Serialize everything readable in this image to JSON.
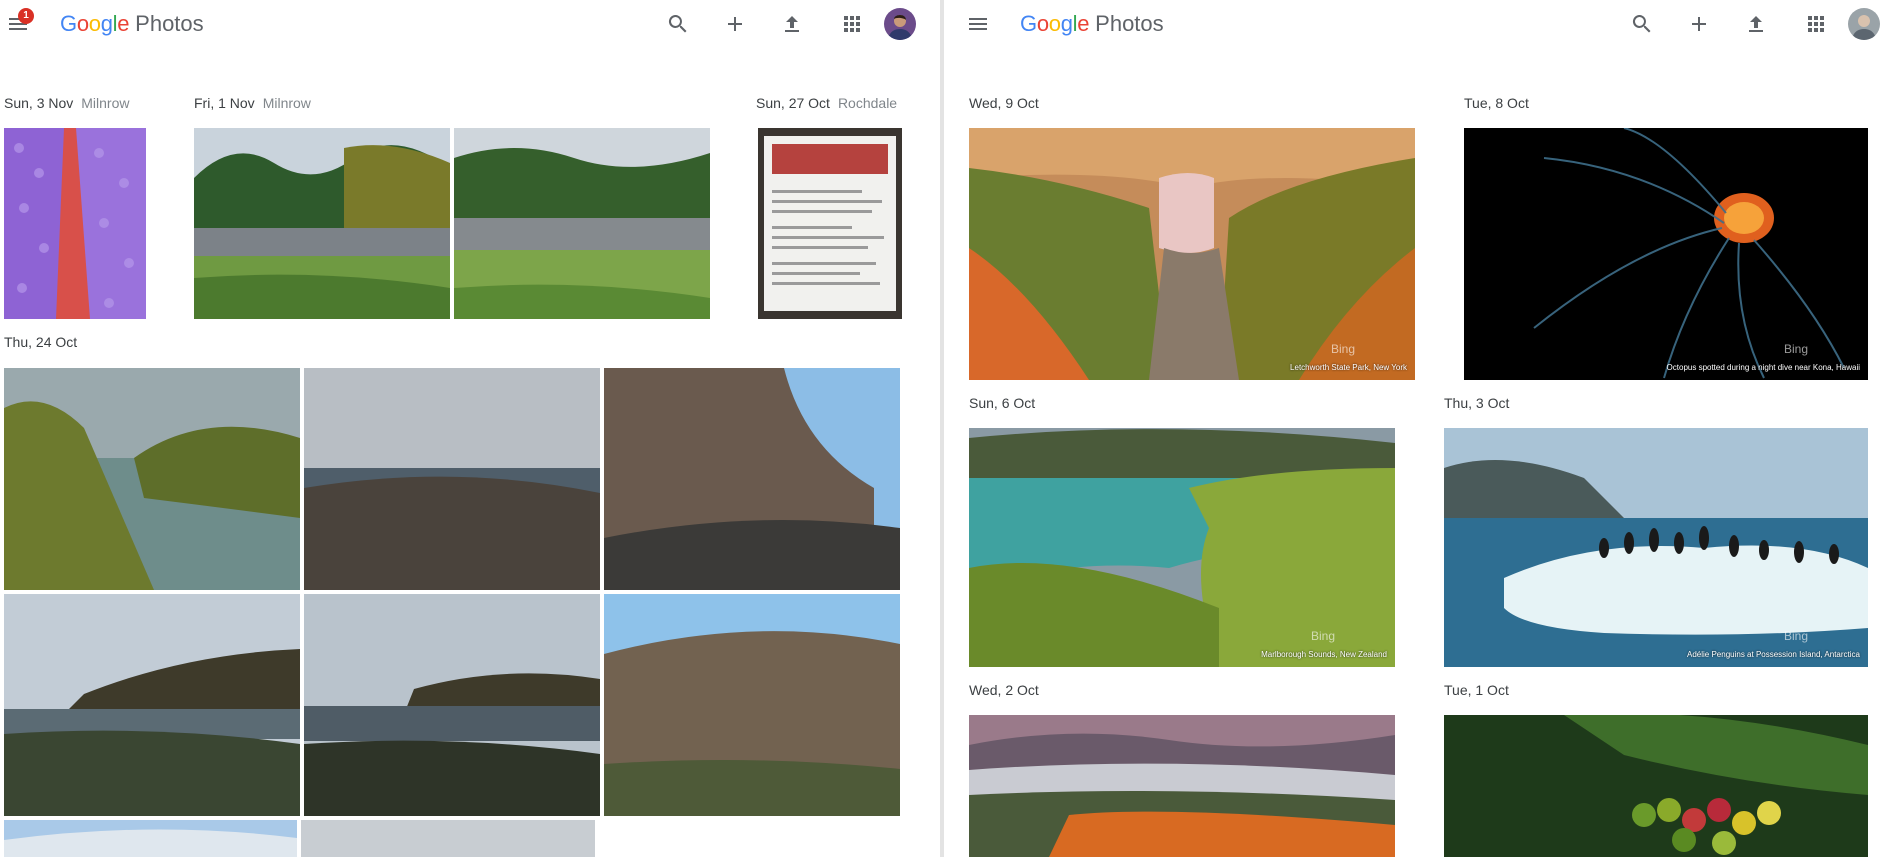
{
  "left": {
    "app": {
      "logo_google": "Google",
      "logo_photos": "Photos",
      "notification_count": "1"
    },
    "toolbar": [
      "search-icon",
      "add-icon",
      "upload-icon",
      "apps-icon"
    ],
    "groups": [
      {
        "date": "Sun, 3 Nov",
        "location": "Milnrow"
      },
      {
        "date": "Fri, 1 Nov",
        "location": "Milnrow"
      },
      {
        "date": "Sun, 27 Oct",
        "location": "Rochdale"
      },
      {
        "date": "Thu, 24 Oct",
        "location": ""
      }
    ]
  },
  "right": {
    "app": {
      "logo_google": "Google",
      "logo_photos": "Photos"
    },
    "toolbar": [
      "search-icon",
      "add-icon",
      "upload-icon",
      "apps-icon"
    ],
    "groups": [
      {
        "date": "Wed, 9 Oct",
        "caption": "Letchworth State Park, New York",
        "watermark": "Bing"
      },
      {
        "date": "Tue, 8 Oct",
        "caption": "Octopus spotted during a night dive near Kona, Hawaii",
        "watermark": "Bing"
      },
      {
        "date": "Sun, 6 Oct",
        "caption": "Marlborough Sounds, New Zealand",
        "watermark": "Bing"
      },
      {
        "date": "Thu, 3 Oct",
        "caption": "Adélie Penguins at Possession Island, Antarctica",
        "watermark": "Bing"
      },
      {
        "date": "Wed, 2 Oct"
      },
      {
        "date": "Tue, 1 Oct"
      }
    ]
  },
  "colors": {
    "accent_red": "#d93025",
    "text": "#3c4043",
    "secondary": "#80868b",
    "icon": "#5f6368"
  }
}
